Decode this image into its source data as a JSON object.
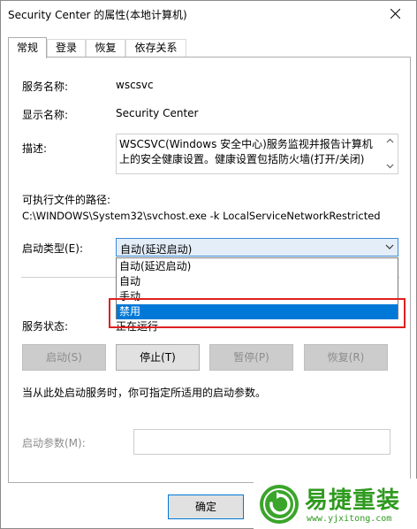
{
  "window": {
    "title": "Security Center 的属性(本地计算机)"
  },
  "tabs": [
    {
      "label": "常规",
      "active": true
    },
    {
      "label": "登录",
      "active": false
    },
    {
      "label": "恢复",
      "active": false
    },
    {
      "label": "依存关系",
      "active": false
    }
  ],
  "general": {
    "service_name_label": "服务名称:",
    "service_name_value": "wscsvc",
    "display_name_label": "显示名称:",
    "display_name_value": "Security Center",
    "description_label": "描述:",
    "description_value": "WSCSVC(Windows 安全中心)服务监视并报告计算机上的安全健康设置。健康设置包括防火墙(打开/关闭)",
    "exe_path_label": "可执行文件的路径:",
    "exe_path_value": "C:\\WINDOWS\\System32\\svchost.exe -k LocalServiceNetworkRestricted",
    "startup_type_label": "启动类型(E):",
    "startup_type_value": "自动(延迟启动)",
    "startup_options": [
      "自动(延迟启动)",
      "自动",
      "手动",
      "禁用"
    ],
    "highlighted_option": "禁用",
    "service_status_label": "服务状态:",
    "service_status_value": "正在运行",
    "hint_text": "当从此处启动服务时，你可指定所适用的启动参数。",
    "start_params_label": "启动参数(M):",
    "start_params_value": ""
  },
  "buttons": {
    "start": "启动(S)",
    "stop": "停止(T)",
    "pause": "暂停(P)",
    "resume": "恢复(R)",
    "ok": "确定"
  },
  "watermark": {
    "title": "易捷重装",
    "url": "www.yjxitong.com"
  },
  "colors": {
    "accent": "#0078d7",
    "highlight_box": "#e02020",
    "watermark_green": "#2f9a1f"
  }
}
